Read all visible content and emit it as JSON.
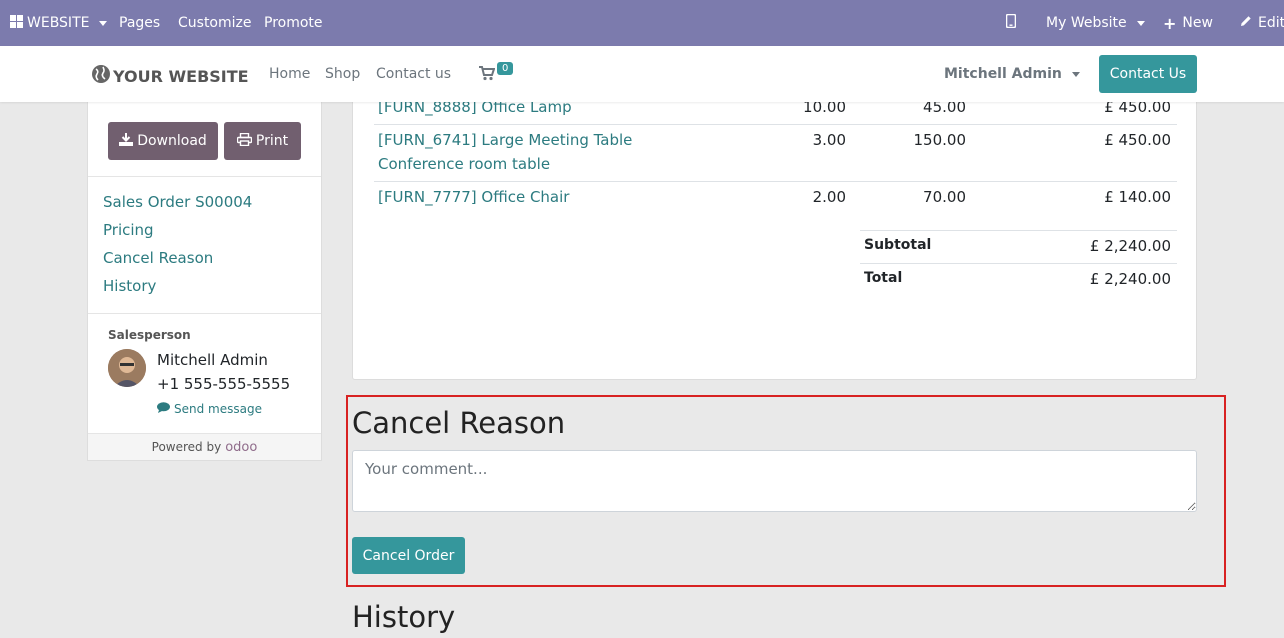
{
  "adminbar": {
    "apps_label": "WEBSITE",
    "menu": [
      "Pages",
      "Customize",
      "Promote"
    ],
    "site_selector": "My Website",
    "new_label": "New",
    "edit_label": "Edit"
  },
  "navbar": {
    "logo_text": "YOUR WEBSITE",
    "links": [
      "Home",
      "Shop",
      "Contact us"
    ],
    "cart_count": "0",
    "user": "Mitchell Admin",
    "contact_button": "Contact Us"
  },
  "sidebar": {
    "download_label": "Download",
    "print_label": "Print",
    "links": [
      "Sales Order S00004",
      "Pricing",
      "Cancel Reason",
      "History"
    ],
    "salesperson_title": "Salesperson",
    "salesperson_name": "Mitchell Admin",
    "salesperson_phone": "+1 555-555-5555",
    "send_message": "Send message",
    "powered_by": "Powered by",
    "powered_brand": "odoo"
  },
  "order": {
    "lines": [
      {
        "product": "[FURN_8888] Office Lamp",
        "qty": "10.00",
        "price": "45.00",
        "amount": "£ 450.00"
      },
      {
        "product": "[FURN_6741] Large Meeting Table",
        "desc": "Conference room table",
        "qty": "3.00",
        "price": "150.00",
        "amount": "£ 450.00"
      },
      {
        "product": "[FURN_7777] Office Chair",
        "qty": "2.00",
        "price": "70.00",
        "amount": "£ 140.00"
      }
    ],
    "subtotal_label": "Subtotal",
    "subtotal": "£ 2,240.00",
    "total_label": "Total",
    "total": "£ 2,240.00"
  },
  "cancel": {
    "heading": "Cancel Reason",
    "placeholder": "Your comment...",
    "button": "Cancel Order"
  },
  "history": {
    "heading": "History"
  },
  "colors": {
    "adminbar": "#7c7bad",
    "primary": "#35979c",
    "secondary": "#715f6f",
    "link": "#2c7b80",
    "highlight_border": "#d82222"
  }
}
